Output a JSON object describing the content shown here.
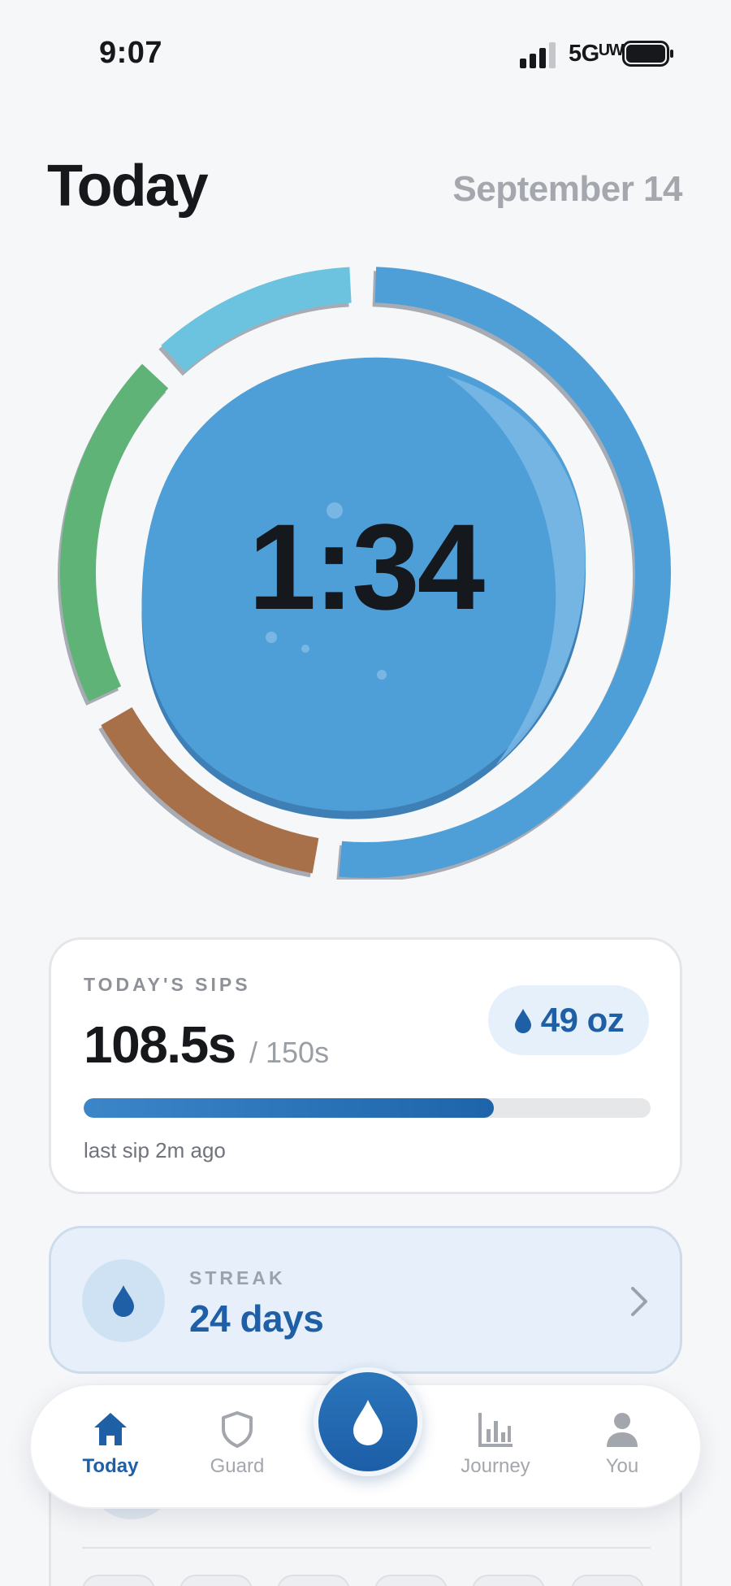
{
  "status_bar": {
    "time": "9:07",
    "network": "5Gᵁᵂ"
  },
  "header": {
    "title": "Today",
    "date": "September 14"
  },
  "ring": {
    "timer": "1:34",
    "segment_colors": {
      "blue": "#4e9ed8",
      "light_blue": "#6cc3e0",
      "green": "#5fb377",
      "brown": "#a87048"
    },
    "center_color": "#4e9ed8"
  },
  "sips_card": {
    "heading": "TODAY'S SIPS",
    "value": "108.5s",
    "goal": "/ 150s",
    "oz": "49 oz",
    "progress": 0.723,
    "last_sip": "last sip 2m ago"
  },
  "streak_card": {
    "heading": "STREAK",
    "value": "24 days"
  },
  "nav": {
    "items": [
      {
        "label": "Today",
        "icon": "home-icon",
        "active": true
      },
      {
        "label": "Guard",
        "icon": "shield-icon",
        "active": false
      },
      {
        "label": "Journey",
        "icon": "bar-chart-icon",
        "active": false
      },
      {
        "label": "You",
        "icon": "person-icon",
        "active": false
      }
    ],
    "center_action_icon": "water-drop-icon"
  },
  "colors": {
    "accent": "#1f5fa6",
    "background": "#f6f7f9"
  }
}
